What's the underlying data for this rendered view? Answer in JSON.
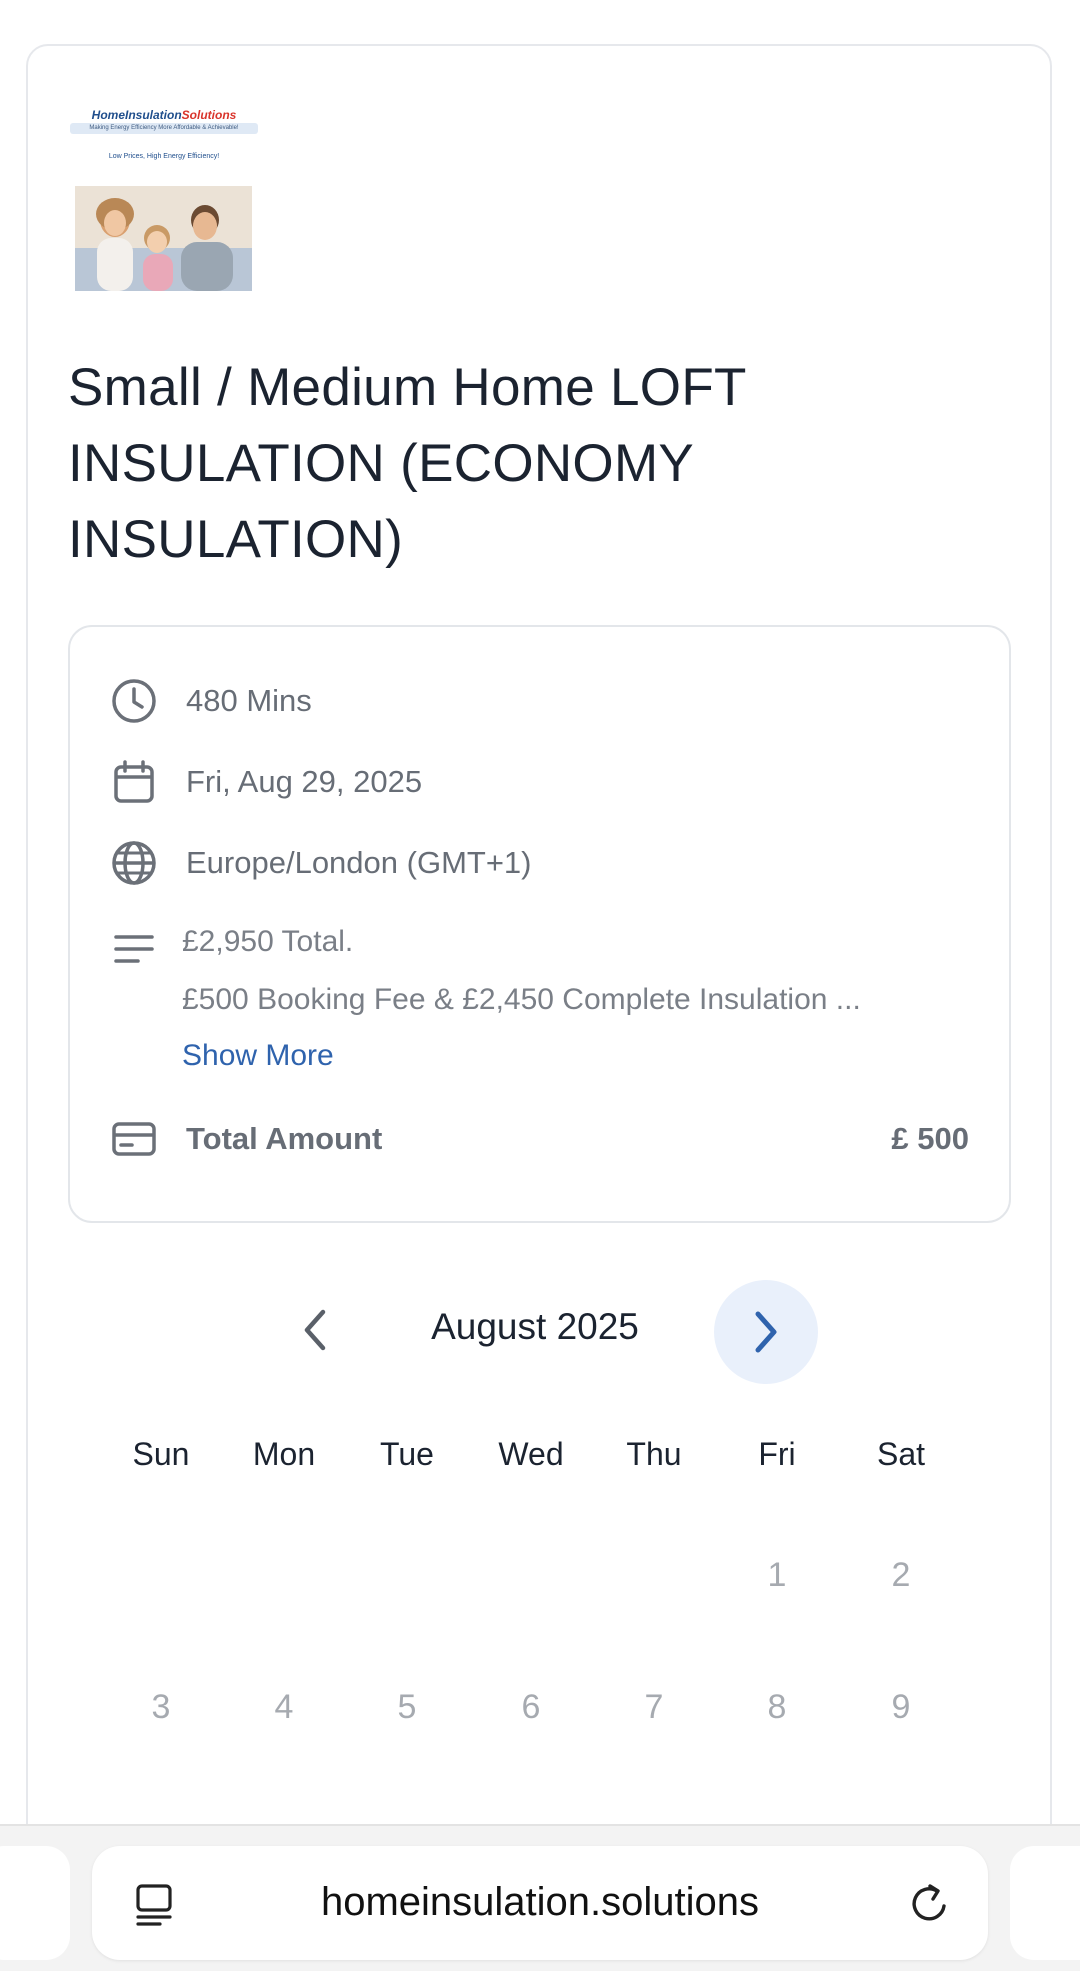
{
  "logo": {
    "brand_primary": "HomeInsulation",
    "brand_accent": "Solutions",
    "tagline": "Making Energy Efficiency More Affordable & Achievable!",
    "slogan": "Low Prices, High Energy Efficiency!"
  },
  "service": {
    "title": "Small / Medium Home LOFT INSULATION (ECONOMY INSULATION)"
  },
  "details": {
    "duration": "480 Mins",
    "date": "Fri, Aug 29, 2025",
    "timezone": "Europe/London (GMT+1)",
    "description_line1": "£2,950 Total.",
    "description_line2": "£500 Booking Fee & £2,450 Complete Insulation ...",
    "show_more": "Show More",
    "total_label": "Total Amount",
    "total_value": "£ 500"
  },
  "calendar": {
    "month_label": "August 2025",
    "weekdays": [
      "Sun",
      "Mon",
      "Tue",
      "Wed",
      "Thu",
      "Fri",
      "Sat"
    ],
    "week1": [
      "",
      "",
      "",
      "",
      "",
      "1",
      "2"
    ],
    "week2": [
      "3",
      "4",
      "5",
      "6",
      "7",
      "8",
      "9"
    ]
  },
  "browser": {
    "url": "homeinsulation.solutions"
  },
  "icons": {
    "duration": "clock-icon",
    "date": "calendar-icon",
    "timezone": "globe-icon",
    "description": "text-lines-icon",
    "total": "credit-card-icon",
    "prev": "chevron-left-icon",
    "next": "chevron-right-icon",
    "reader": "reader-mode-icon",
    "reload": "reload-icon"
  },
  "colors": {
    "link": "#2f63ad",
    "next_button_bg": "#e9f0fb",
    "muted_text": "#676d76"
  }
}
